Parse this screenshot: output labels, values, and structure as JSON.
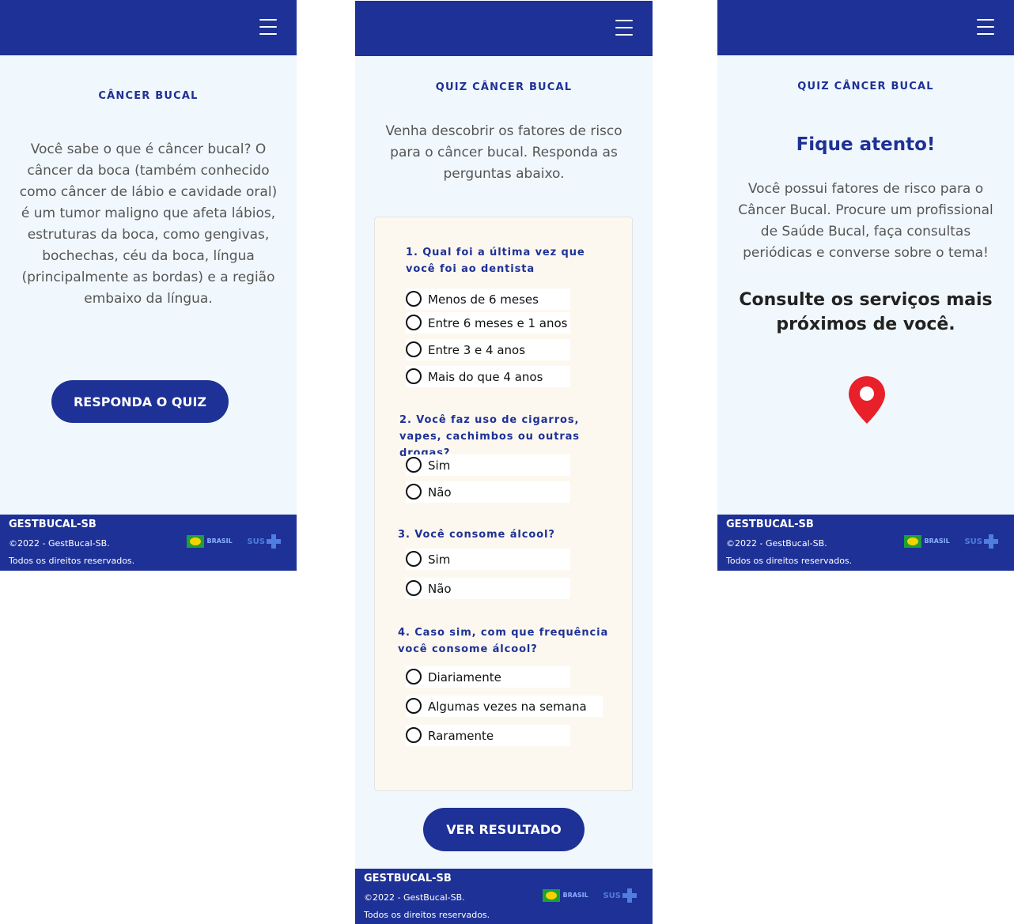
{
  "screen1": {
    "eyebrow": "CÂNCER BUCAL",
    "intro": "Você sabe o que é câncer bucal? O câncer da boca (também conhecido como câncer de lábio e cavidade oral) é um tumor maligno que afeta lábios, estruturas da boca, como  gengivas, bochechas, céu da boca, língua (principalmente as bordas) e a região embaixo da língua.",
    "cta": "RESPONDA O QUIZ"
  },
  "screen2": {
    "eyebrow": "QUIZ CÂNCER BUCAL",
    "intro": "Venha descobrir os fatores de risco para o câncer bucal. Responda as perguntas abaixo.",
    "questions": [
      {
        "text": "1. Qual foi a última vez que você foi ao dentista",
        "options": [
          "Menos de 6 meses",
          "Entre 6 meses e 1 anos",
          "Entre 3 e 4 anos",
          "Mais do que 4 anos"
        ]
      },
      {
        "text": "2. Você faz uso de cigarros, vapes, cachimbos ou outras drogas?",
        "options": [
          "Sim",
          "Não"
        ]
      },
      {
        "text": "3. Você consome álcool?",
        "options": [
          "Sim",
          "Não"
        ]
      },
      {
        "text": "4. Caso sim, com que frequência você consome álcool?",
        "options": [
          "Diariamente",
          "Algumas vezes na semana",
          "Raramente"
        ]
      }
    ],
    "cta": "VER RESULTADO"
  },
  "screen3": {
    "eyebrow": "QUIZ CÂNCER BUCAL",
    "headline": "Fique atento!",
    "message": "Você possui fatores de risco para o Câncer Bucal. Procure um profissional de Saúde Bucal, faça consultas periódicas e converse sobre o tema!",
    "consult": "Consulte os serviços mais próximos de você."
  },
  "footer": {
    "brand": "GESTBUCAL-SB",
    "copyright": "©2022 - GestBucal-SB.",
    "rights": "Todos os direitos reservados.",
    "logo_gov_text": "BRASIL",
    "logo_sus_text": "SUS"
  },
  "colors": {
    "primary": "#1e3196",
    "background": "#f1f8fd",
    "card": "#fdf8ef",
    "pin": "#e8202a"
  },
  "icons": {
    "menu": "hamburger-menu-icon",
    "pin": "map-pin-icon"
  }
}
